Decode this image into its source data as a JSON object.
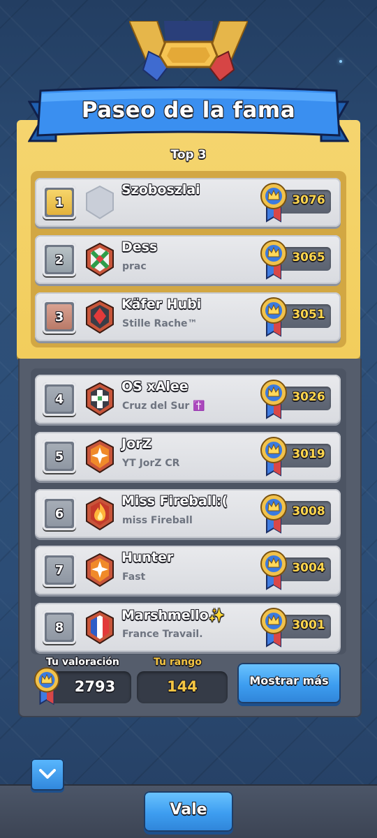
{
  "header": {
    "title": "Paseo de la fama",
    "subtitle": "Top 3"
  },
  "players": [
    {
      "rank": "1",
      "name": "Szoboszlai",
      "clan": "",
      "trophies": "3076",
      "badge": "empty-badge-icon"
    },
    {
      "rank": "2",
      "name": "Dess",
      "clan": "prac",
      "trophies": "3065",
      "badge": "green-cross-clan-badge-icon"
    },
    {
      "rank": "3",
      "name": "Käfer Hubi",
      "clan": "Stille Rache™",
      "trophies": "3051",
      "badge": "red-diamond-clan-badge-icon"
    },
    {
      "rank": "4",
      "name": "OS xAlee",
      "clan": "Cruz del Sur ✝️",
      "trophies": "3026",
      "badge": "white-cross-clan-badge-icon"
    },
    {
      "rank": "5",
      "name": "JorZ",
      "clan": "YT JorZ CR",
      "trophies": "3019",
      "badge": "orange-star-clan-badge-icon"
    },
    {
      "rank": "6",
      "name": "Miss Fireball:(",
      "clan": "miss Fireball",
      "trophies": "3008",
      "badge": "fire-clan-badge-icon"
    },
    {
      "rank": "7",
      "name": "Hunter",
      "clan": "Fast",
      "trophies": "3004",
      "badge": "orange-star-clan-badge-icon"
    },
    {
      "rank": "8",
      "name": "Marshmello✨",
      "clan": "France Travail.",
      "trophies": "3001",
      "badge": "french-flag-clan-badge-icon"
    }
  ],
  "my_stats": {
    "rating_label": "Tu valoración",
    "rating_value": "2793",
    "rank_label": "Tu rango",
    "rank_value": "144"
  },
  "buttons": {
    "show_more": "Mostrar más",
    "ok": "Vale"
  },
  "colors": {
    "gold_panel": "#f2cd5c",
    "score_text": "#ffd64d",
    "button_blue": "#3d9df0",
    "rank_label_gold": "#f4c542"
  }
}
